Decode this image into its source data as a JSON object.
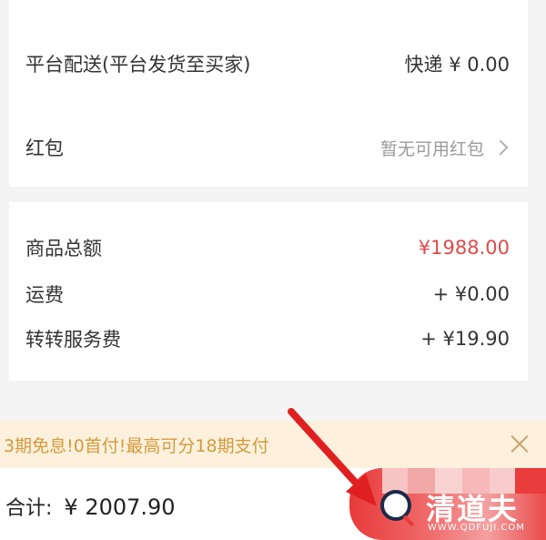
{
  "delivery": {
    "label": "平台配送(平台发货至买家)",
    "value": "快递 ¥ 0.00"
  },
  "red_packet": {
    "label": "红包",
    "value": "暂无可用红包"
  },
  "fees": {
    "goods_total_label": "商品总额",
    "goods_total_value": "¥1988.00",
    "shipping_label": "运费",
    "shipping_value": "+ ¥0.00",
    "service_fee_label": "转转服务费",
    "service_fee_value": "+ ¥19.90"
  },
  "promo": {
    "text": "3期免息!0首付!最高可分18期支付"
  },
  "bottom": {
    "total_label": "合计:",
    "total_value": "¥ 2007.90"
  },
  "watermark": {
    "title": "清道夫",
    "url": "WWW.QDFUJI.COM"
  },
  "colors": {
    "accent_red": "#e04a4a",
    "promo_text": "#d29a3d",
    "promo_bg": "#fdf1dd",
    "arrow": "#e02020"
  }
}
